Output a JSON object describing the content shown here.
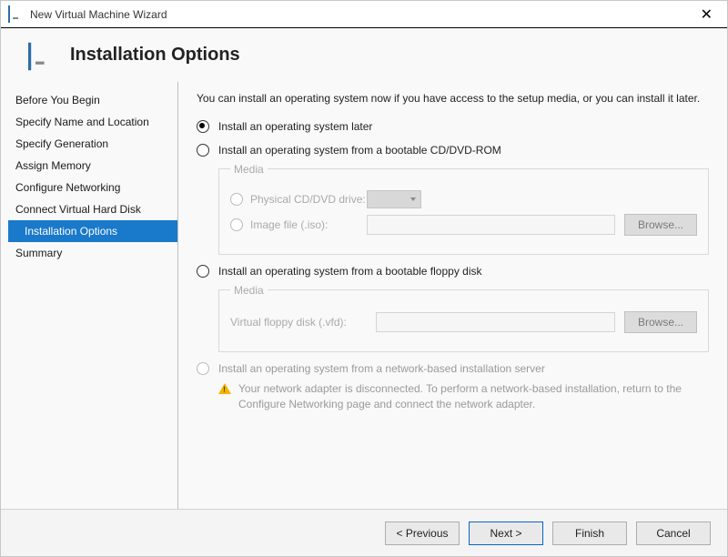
{
  "window": {
    "title": "New Virtual Machine Wizard"
  },
  "header": {
    "title": "Installation Options"
  },
  "sidebar": {
    "steps": [
      "Before You Begin",
      "Specify Name and Location",
      "Specify Generation",
      "Assign Memory",
      "Configure Networking",
      "Connect Virtual Hard Disk",
      "Installation Options",
      "Summary"
    ],
    "activeIndex": 6
  },
  "content": {
    "intro": "You can install an operating system now if you have access to the setup media, or you can install it later.",
    "option_later": "Install an operating system later",
    "option_cddvd": "Install an operating system from a bootable CD/DVD-ROM",
    "media_legend": "Media",
    "physical_drive_label": "Physical CD/DVD drive:",
    "image_file_label": "Image file (.iso):",
    "browse_label": "Browse...",
    "option_floppy": "Install an operating system from a bootable floppy disk",
    "vfd_label": "Virtual floppy disk (.vfd):",
    "option_network": "Install an operating system from a network-based installation server",
    "network_warning": "Your network adapter is disconnected. To perform a network-based installation, return to the Configure Networking page and connect the network adapter."
  },
  "footer": {
    "previous": "< Previous",
    "next": "Next >",
    "finish": "Finish",
    "cancel": "Cancel"
  }
}
